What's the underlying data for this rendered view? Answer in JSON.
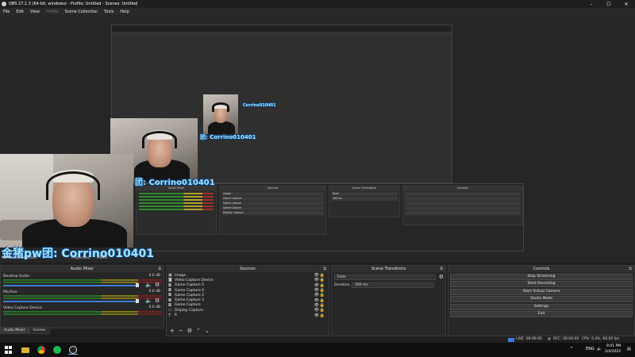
{
  "window": {
    "title": "OBS 27.1.3 (64-bit, windows) - Profile: Untitled - Scenes: Untitled",
    "controls": [
      "–",
      "☐",
      "✕"
    ]
  },
  "menu": [
    "File",
    "Edit",
    "View",
    "Profile",
    "Scene Collection",
    "Tools",
    "Help"
  ],
  "preview": {
    "overlay_text": "金猪pw团: Corrino010401",
    "overlay_text_small": "团: Corrino010401",
    "overlay_text_tiny": "Corrino010401",
    "no_source": "No source selected",
    "properties_label": "Properties",
    "filters_label": "Filters"
  },
  "audio_mixer": {
    "title": "Audio Mixer",
    "channels": [
      {
        "name": "Desktop Audio",
        "db": "0.0 dB"
      },
      {
        "name": "Mic/Aux",
        "db": "0.0 dB"
      },
      {
        "name": "Video Capture Device",
        "db": "0.0 dB"
      }
    ]
  },
  "dock_tabs": [
    "Audio Mixer",
    "Scenes"
  ],
  "sources": {
    "title": "Sources",
    "items": [
      {
        "label": "Image",
        "icon": "image-icon"
      },
      {
        "label": "Video Capture Device",
        "icon": "camera-icon"
      },
      {
        "label": "Game Capture 5",
        "icon": "gamepad-icon"
      },
      {
        "label": "Game Capture 4",
        "icon": "gamepad-icon"
      },
      {
        "label": "Game Capture 2",
        "icon": "gamepad-icon"
      },
      {
        "label": "Game Capture 3",
        "icon": "gamepad-icon"
      },
      {
        "label": "Game Capture",
        "icon": "gamepad-icon"
      },
      {
        "label": "Display Capture",
        "icon": "monitor-icon"
      },
      {
        "label": "6",
        "icon": "text-icon"
      }
    ]
  },
  "transitions": {
    "title": "Scene Transitions",
    "selected": "Fade",
    "duration_label": "Duration",
    "duration_value": "300 ms"
  },
  "controls": {
    "title": "Controls",
    "buttons": [
      "Stop Streaming",
      "Start Recording",
      "Start Virtual Camera",
      "Studio Mode",
      "Settings",
      "Exit"
    ]
  },
  "status": {
    "live": "LIVE: 00:00:00",
    "rec": "REC: 00:00:00",
    "cpu": "CPU: 0.4%, 60.00 fps"
  },
  "taskbar": {
    "lang": "ENG",
    "time": "9:01 PM",
    "date": "2/4/2022"
  },
  "colors": {
    "accent": "#3b7dd8",
    "live_indicator": "#3b7dd8",
    "overlay_text": "#9fe7ff"
  }
}
